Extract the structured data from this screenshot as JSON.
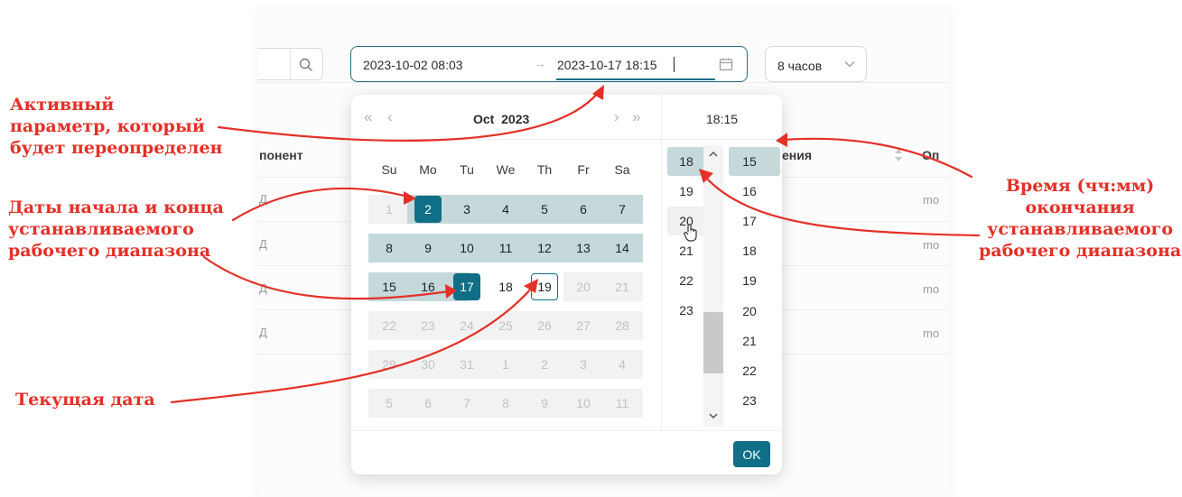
{
  "toolbar": {
    "range_start": "2023-10-02 08:03",
    "range_arrow": "→",
    "range_end": "2023-10-17 18:15",
    "period_value": "8 часов"
  },
  "background_table": {
    "headers": [
      "понент",
      "ения",
      "Оп"
    ],
    "rows": [
      {
        "left": "Д",
        "right": "mo"
      },
      {
        "left": "Д",
        "right": "mo"
      },
      {
        "left": "Д",
        "right": "mo"
      },
      {
        "left": "Д",
        "right": "mo"
      }
    ]
  },
  "calendar": {
    "nav": {
      "prev_year": "«",
      "prev_month": "‹",
      "next_month": "›",
      "next_year": "»"
    },
    "month_label": "Oct  2023",
    "weekdays": [
      "Su",
      "Mo",
      "Tu",
      "We",
      "Th",
      "Fr",
      "Sa"
    ],
    "weeks": [
      [
        "1",
        "2",
        "3",
        "4",
        "5",
        "6",
        "7"
      ],
      [
        "8",
        "9",
        "10",
        "11",
        "12",
        "13",
        "14"
      ],
      [
        "15",
        "16",
        "17",
        "18",
        "19",
        "20",
        "21"
      ],
      [
        "22",
        "23",
        "24",
        "25",
        "26",
        "27",
        "28"
      ],
      [
        "29",
        "30",
        "31",
        "1",
        "2",
        "3",
        "4"
      ],
      [
        "5",
        "6",
        "7",
        "8",
        "9",
        "10",
        "11"
      ]
    ],
    "range_start_day": "2",
    "range_end_day": "17",
    "today_day": "19"
  },
  "time": {
    "header": "18:15",
    "hours": [
      "18",
      "19",
      "20",
      "21",
      "22",
      "23"
    ],
    "minutes": [
      "15",
      "16",
      "17",
      "18",
      "19",
      "20",
      "21",
      "22",
      "23"
    ],
    "selected_hour": "18",
    "selected_minute": "15"
  },
  "ok_label": "OK",
  "annotations": {
    "active_param": [
      "Активный",
      "параметр, который",
      "будет переопределен"
    ],
    "range_dates": [
      "Даты начала и конца",
      "устанавливаемого",
      "рабочего диапазона"
    ],
    "end_time": [
      "Время (чч:мм)",
      "окончания",
      "устанавливаемого",
      "рабочего диапазона"
    ],
    "current_date": "Текущая дата"
  },
  "colors": {
    "accent": "#106e87",
    "range_band": "#c5d9db",
    "annotation": "#e43027"
  },
  "icons": [
    "search-icon",
    "calendar-icon",
    "chevron-down-icon",
    "sort-icon",
    "scroll-up-icon",
    "scroll-down-icon",
    "hand-cursor-icon"
  ]
}
